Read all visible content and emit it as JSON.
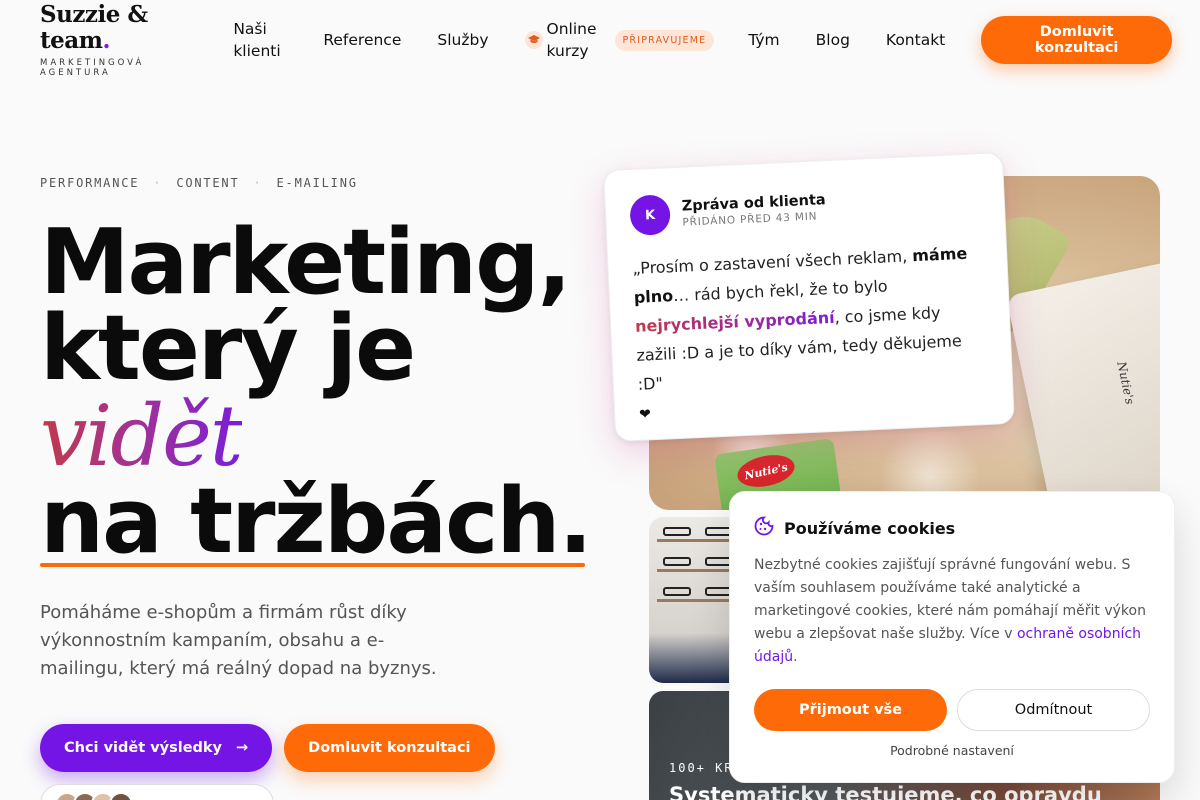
{
  "brand": {
    "name": "Suzzie & team",
    "dot": ".",
    "tagline": "MARKETINGOVÁ AGENTURA"
  },
  "nav": {
    "items": [
      {
        "label": "Naši klienti"
      },
      {
        "label": "Reference"
      },
      {
        "label": "Služby"
      },
      {
        "label": "Online kurzy",
        "badge": "PŘIPRAVUJEME",
        "icon": "graduation-cap-icon"
      },
      {
        "label": "Tým"
      },
      {
        "label": "Blog"
      },
      {
        "label": "Kontakt"
      }
    ],
    "cta": "Domluvit konzultaci"
  },
  "hero": {
    "eyebrow": [
      "PERFORMANCE",
      "CONTENT",
      "E-MAILING"
    ],
    "eyebrow_sep": "·",
    "headline": {
      "line1": "Marketing,",
      "line2": "který je",
      "accent": "vidět",
      "line4": "na tržbách."
    },
    "lead": "Pomáháme e-shopům a firmám růst díky výkonnostním kampaním, obsahu a e-mailingu, který má reálný dopad na byznys.",
    "cta_primary": "Chci vidět výsledky",
    "cta_primary_icon": "→",
    "cta_secondary": "Domluvit konzultaci"
  },
  "client_message": {
    "avatar_initial": "K",
    "title": "Zpráva od klienta",
    "time": "PŘIDÁNO PŘED 43 MIN",
    "body_part1": "„Prosím o zastavení všech reklam, ",
    "body_bold": "máme plno",
    "body_part2": "… rád bych řekl, že to bylo ",
    "body_highlight": "nejrychlejší vyprodání",
    "body_part3": ", co jsme kdy zažili :D a je to díky vám, tedy děkujeme :D\"",
    "heart": "❤"
  },
  "images": {
    "main_brand": "Nutie's",
    "main_bag_label": "Nutie's",
    "bottom_tag": "100+ KR",
    "bottom_title": "Systematicky testujeme, co opravdu"
  },
  "cookies": {
    "title": "Používáme cookies",
    "icon": "cookie-icon",
    "text": "Nezbytné cookies zajišťují správné fungování webu. S vaším souhlasem používáme také analytické a marketingové cookies, které nám pomáhají měřit výkon webu a zlepšovat naše služby. Více v ",
    "link": "ochraně osobních údajů",
    "text_end": ".",
    "accept": "Přijmout vše",
    "reject": "Odmítnout",
    "settings": "Podrobné nastavení"
  },
  "colors": {
    "accent_orange": "#ff6a08",
    "accent_purple": "#7415e6",
    "badge_bg": "#fde6d8",
    "badge_text": "#e25a1c"
  }
}
